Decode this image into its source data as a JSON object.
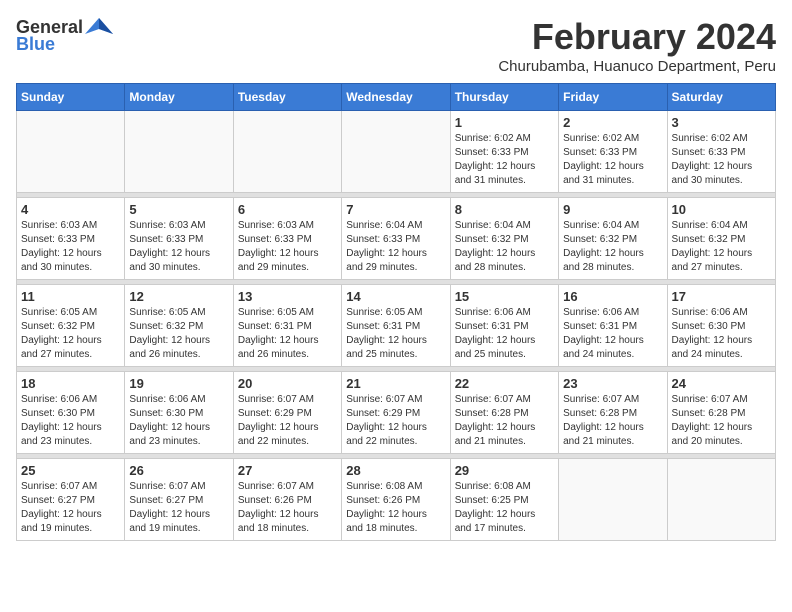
{
  "logo": {
    "general": "General",
    "blue": "Blue"
  },
  "title": "February 2024",
  "subtitle": "Churubamba, Huanuco Department, Peru",
  "days_of_week": [
    "Sunday",
    "Monday",
    "Tuesday",
    "Wednesday",
    "Thursday",
    "Friday",
    "Saturday"
  ],
  "weeks": [
    [
      {
        "day": "",
        "info": ""
      },
      {
        "day": "",
        "info": ""
      },
      {
        "day": "",
        "info": ""
      },
      {
        "day": "",
        "info": ""
      },
      {
        "day": "1",
        "info": "Sunrise: 6:02 AM\nSunset: 6:33 PM\nDaylight: 12 hours and 31 minutes."
      },
      {
        "day": "2",
        "info": "Sunrise: 6:02 AM\nSunset: 6:33 PM\nDaylight: 12 hours and 31 minutes."
      },
      {
        "day": "3",
        "info": "Sunrise: 6:02 AM\nSunset: 6:33 PM\nDaylight: 12 hours and 30 minutes."
      }
    ],
    [
      {
        "day": "4",
        "info": "Sunrise: 6:03 AM\nSunset: 6:33 PM\nDaylight: 12 hours and 30 minutes."
      },
      {
        "day": "5",
        "info": "Sunrise: 6:03 AM\nSunset: 6:33 PM\nDaylight: 12 hours and 30 minutes."
      },
      {
        "day": "6",
        "info": "Sunrise: 6:03 AM\nSunset: 6:33 PM\nDaylight: 12 hours and 29 minutes."
      },
      {
        "day": "7",
        "info": "Sunrise: 6:04 AM\nSunset: 6:33 PM\nDaylight: 12 hours and 29 minutes."
      },
      {
        "day": "8",
        "info": "Sunrise: 6:04 AM\nSunset: 6:32 PM\nDaylight: 12 hours and 28 minutes."
      },
      {
        "day": "9",
        "info": "Sunrise: 6:04 AM\nSunset: 6:32 PM\nDaylight: 12 hours and 28 minutes."
      },
      {
        "day": "10",
        "info": "Sunrise: 6:04 AM\nSunset: 6:32 PM\nDaylight: 12 hours and 27 minutes."
      }
    ],
    [
      {
        "day": "11",
        "info": "Sunrise: 6:05 AM\nSunset: 6:32 PM\nDaylight: 12 hours and 27 minutes."
      },
      {
        "day": "12",
        "info": "Sunrise: 6:05 AM\nSunset: 6:32 PM\nDaylight: 12 hours and 26 minutes."
      },
      {
        "day": "13",
        "info": "Sunrise: 6:05 AM\nSunset: 6:31 PM\nDaylight: 12 hours and 26 minutes."
      },
      {
        "day": "14",
        "info": "Sunrise: 6:05 AM\nSunset: 6:31 PM\nDaylight: 12 hours and 25 minutes."
      },
      {
        "day": "15",
        "info": "Sunrise: 6:06 AM\nSunset: 6:31 PM\nDaylight: 12 hours and 25 minutes."
      },
      {
        "day": "16",
        "info": "Sunrise: 6:06 AM\nSunset: 6:31 PM\nDaylight: 12 hours and 24 minutes."
      },
      {
        "day": "17",
        "info": "Sunrise: 6:06 AM\nSunset: 6:30 PM\nDaylight: 12 hours and 24 minutes."
      }
    ],
    [
      {
        "day": "18",
        "info": "Sunrise: 6:06 AM\nSunset: 6:30 PM\nDaylight: 12 hours and 23 minutes."
      },
      {
        "day": "19",
        "info": "Sunrise: 6:06 AM\nSunset: 6:30 PM\nDaylight: 12 hours and 23 minutes."
      },
      {
        "day": "20",
        "info": "Sunrise: 6:07 AM\nSunset: 6:29 PM\nDaylight: 12 hours and 22 minutes."
      },
      {
        "day": "21",
        "info": "Sunrise: 6:07 AM\nSunset: 6:29 PM\nDaylight: 12 hours and 22 minutes."
      },
      {
        "day": "22",
        "info": "Sunrise: 6:07 AM\nSunset: 6:28 PM\nDaylight: 12 hours and 21 minutes."
      },
      {
        "day": "23",
        "info": "Sunrise: 6:07 AM\nSunset: 6:28 PM\nDaylight: 12 hours and 21 minutes."
      },
      {
        "day": "24",
        "info": "Sunrise: 6:07 AM\nSunset: 6:28 PM\nDaylight: 12 hours and 20 minutes."
      }
    ],
    [
      {
        "day": "25",
        "info": "Sunrise: 6:07 AM\nSunset: 6:27 PM\nDaylight: 12 hours and 19 minutes."
      },
      {
        "day": "26",
        "info": "Sunrise: 6:07 AM\nSunset: 6:27 PM\nDaylight: 12 hours and 19 minutes."
      },
      {
        "day": "27",
        "info": "Sunrise: 6:07 AM\nSunset: 6:26 PM\nDaylight: 12 hours and 18 minutes."
      },
      {
        "day": "28",
        "info": "Sunrise: 6:08 AM\nSunset: 6:26 PM\nDaylight: 12 hours and 18 minutes."
      },
      {
        "day": "29",
        "info": "Sunrise: 6:08 AM\nSunset: 6:25 PM\nDaylight: 12 hours and 17 minutes."
      },
      {
        "day": "",
        "info": ""
      },
      {
        "day": "",
        "info": ""
      }
    ]
  ]
}
